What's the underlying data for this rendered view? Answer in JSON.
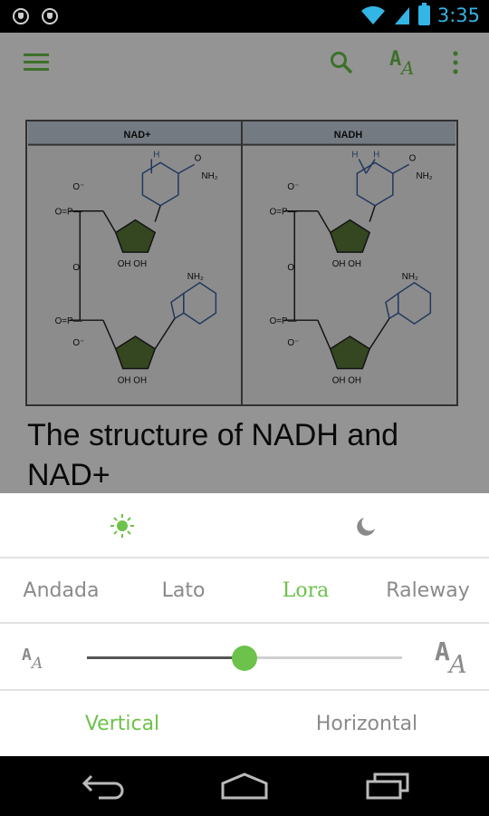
{
  "status_bar": {
    "time": "3:35",
    "icons": [
      "notification-icon",
      "notification-icon",
      "wifi-icon",
      "signal-icon",
      "battery-icon"
    ]
  },
  "toolbar": {
    "icons": [
      "menu-icon",
      "search-icon",
      "font-settings-icon",
      "more-icon"
    ]
  },
  "article": {
    "image": {
      "left_header": "NAD+",
      "right_header": "NADH"
    },
    "title": "The structure of NADH and NAD+"
  },
  "settings": {
    "theme": {
      "day_icon": "sun-icon",
      "night_icon": "moon-icon",
      "selected": "day"
    },
    "fonts": [
      {
        "label": "Andada",
        "selected": false
      },
      {
        "label": "Lato",
        "selected": false
      },
      {
        "label": "Lora",
        "selected": true
      },
      {
        "label": "Raleway",
        "selected": false
      }
    ],
    "font_size": {
      "value_fraction": 0.5
    },
    "orientation": [
      {
        "label": "Vertical",
        "selected": true
      },
      {
        "label": "Horizontal",
        "selected": false
      }
    ]
  },
  "colors": {
    "accent": "#6cc24a",
    "status_accent": "#33b5e5",
    "text_muted": "#8a8a8a"
  },
  "nav_bar": {
    "icons": [
      "back-icon",
      "home-icon",
      "recents-icon"
    ]
  }
}
